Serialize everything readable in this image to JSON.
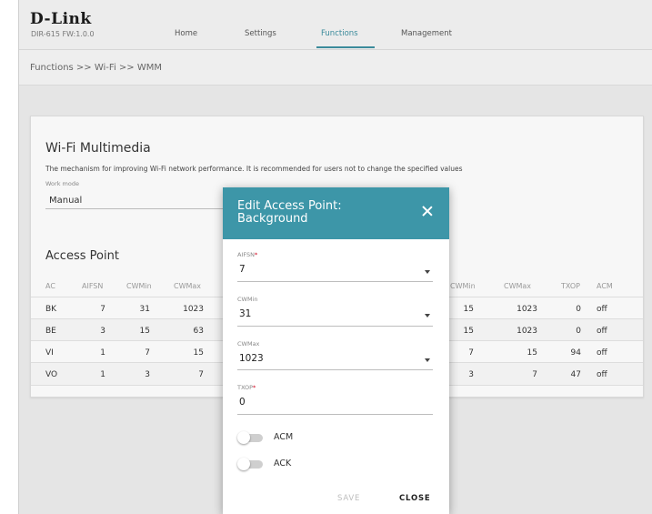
{
  "header": {
    "logo": "D-Link",
    "model": "DIR-615 FW:1.0.0",
    "nav": [
      {
        "label": "Home"
      },
      {
        "label": "Settings"
      },
      {
        "label": "Functions"
      },
      {
        "label": "Management"
      }
    ],
    "active_nav": "Functions"
  },
  "breadcrumb": "Functions >> Wi-Fi >> WMM",
  "wmm": {
    "title": "Wi-Fi Multimedia",
    "description": "The mechanism for improving Wi-Fi network performance. It is recommended for users not to change the specified values",
    "work_mode_label": "Work mode",
    "work_mode_value": "Manual"
  },
  "access_point": {
    "title": "Access Point",
    "left_headers": [
      "AC",
      "AIFSN",
      "CWMin",
      "CWMax"
    ],
    "right_headers": [
      "CWMin",
      "CWMax",
      "TXOP",
      "ACM"
    ],
    "rows": [
      {
        "ac": "BK",
        "aifsn": "7",
        "cwmin": "31",
        "cwmax": "1023",
        "r_cwmin": "15",
        "r_cwmax": "1023",
        "txop": "0",
        "acm": "off"
      },
      {
        "ac": "BE",
        "aifsn": "3",
        "cwmin": "15",
        "cwmax": "63",
        "r_cwmin": "15",
        "r_cwmax": "1023",
        "txop": "0",
        "acm": "off"
      },
      {
        "ac": "VI",
        "aifsn": "1",
        "cwmin": "7",
        "cwmax": "15",
        "r_cwmin": "7",
        "r_cwmax": "15",
        "txop": "94",
        "acm": "off"
      },
      {
        "ac": "VO",
        "aifsn": "1",
        "cwmin": "3",
        "cwmax": "7",
        "r_cwmin": "3",
        "r_cwmax": "7",
        "txop": "47",
        "acm": "off"
      }
    ]
  },
  "modal": {
    "title": "Edit Access Point: Background",
    "aifsn_label": "AIFSN",
    "aifsn_value": "7",
    "cwmin_label": "CWMin",
    "cwmin_value": "31",
    "cwmax_label": "CWMax",
    "cwmax_value": "1023",
    "txop_label": "TXOP",
    "txop_value": "0",
    "required_mark": "*",
    "acm_label": "ACM",
    "acm_on": false,
    "ack_label": "ACK",
    "ack_on": false,
    "save_label": "SAVE",
    "close_label": "CLOSE"
  },
  "colors": {
    "accent": "#3d96a8",
    "required": "#d0021b"
  }
}
